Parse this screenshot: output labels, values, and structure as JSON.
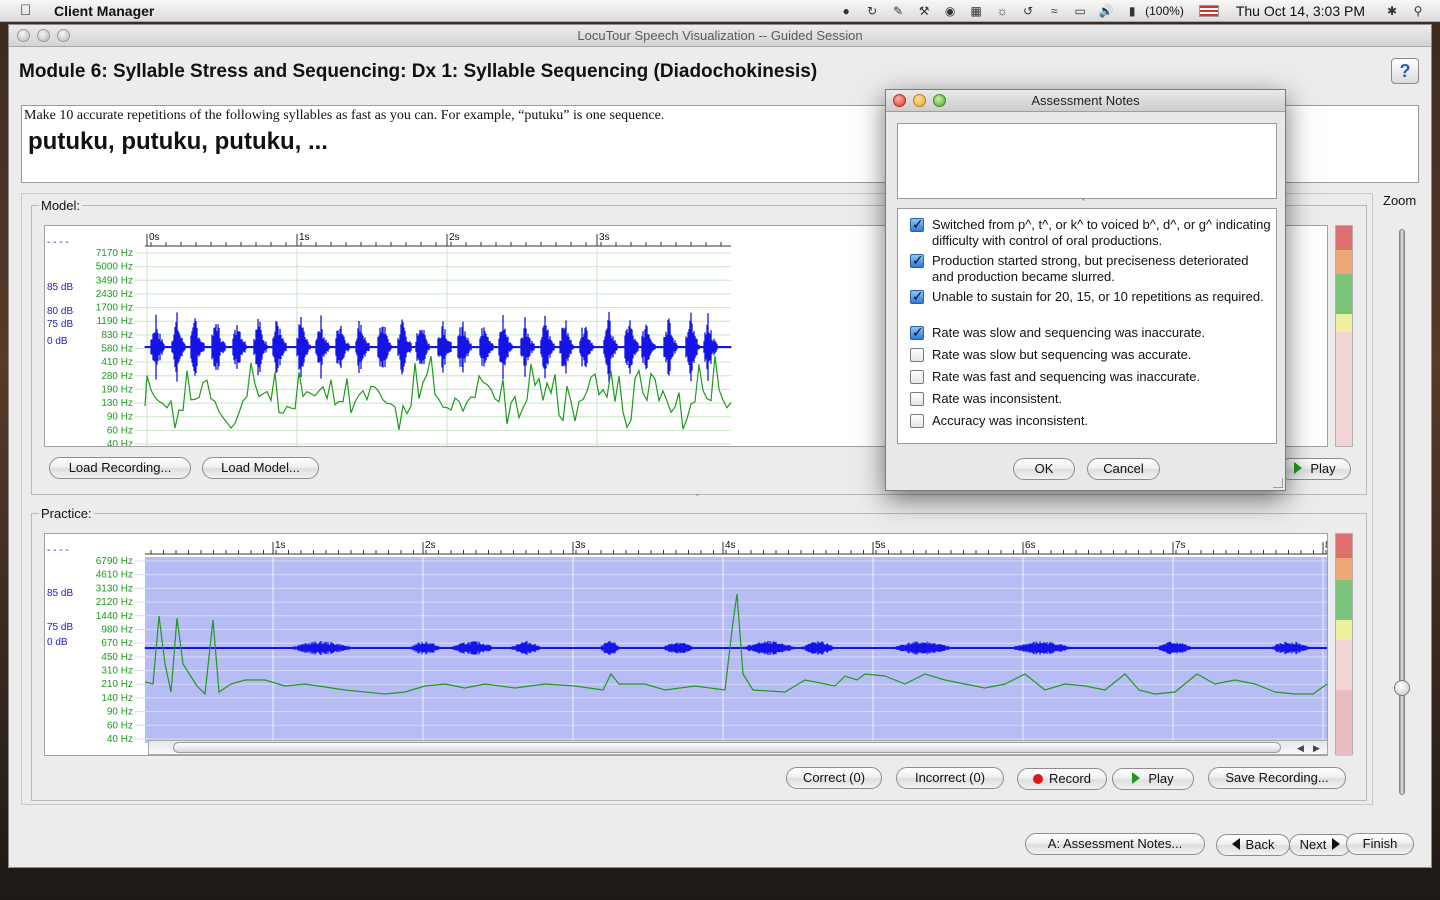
{
  "menubar": {
    "app_name": "Client Manager",
    "battery": "(100%)",
    "clock": "Thu Oct 14,  3:03 PM"
  },
  "window": {
    "title": "LocuTour Speech Visualization -- Guided Session",
    "module_title": "Module 6: Syllable Stress and Sequencing: Dx 1: Syllable Sequencing (Diadochokinesis)",
    "help_label": "?"
  },
  "instructions": {
    "text": "Make 10 accurate repetitions of the following syllables as fast as you can. For example, “putuku” is one sequence.",
    "target": "putuku, putuku, putuku, ..."
  },
  "model_panel": {
    "label": "Model:",
    "db_labels": [
      "85 dB",
      "80 dB",
      "75 dB",
      "0 dB"
    ],
    "freq_labels": [
      "7170 Hz",
      "5000 Hz",
      "3490 Hz",
      "2430 Hz",
      "1700 Hz",
      "1190 Hz",
      "830 Hz",
      "580 Hz",
      "410 Hz",
      "280 Hz",
      "190 Hz",
      "130 Hz",
      "90 Hz",
      "60 Hz",
      "40 Hz"
    ],
    "time_labels": [
      "0s",
      "1s",
      "2s",
      "3s"
    ],
    "load_recording": "Load Recording...",
    "load_model": "Load Model...",
    "play": "Play"
  },
  "practice_panel": {
    "label": "Practice:",
    "db_labels": [
      "85 dB",
      "75 dB",
      "0 dB"
    ],
    "freq_labels": [
      "6790 Hz",
      "4610 Hz",
      "3130 Hz",
      "2120 Hz",
      "1440 Hz",
      "980 Hz",
      "670 Hz",
      "450 Hz",
      "310 Hz",
      "210 Hz",
      "140 Hz",
      "90 Hz",
      "60 Hz",
      "40 Hz"
    ],
    "time_labels": [
      "1s",
      "2s",
      "3s",
      "4s",
      "5s",
      "6s",
      "7s",
      "8"
    ],
    "correct": "Correct (0)",
    "incorrect": "Incorrect (0)",
    "record": "Record",
    "play": "Play",
    "save_recording": "Save Recording..."
  },
  "zoom": {
    "label": "Zoom"
  },
  "footer": {
    "assessment_notes": "A: Assessment Notes...",
    "back": "Back",
    "next": "Next",
    "finish": "Finish"
  },
  "dialog": {
    "title": "Assessment Notes",
    "notes_value": "",
    "items": [
      {
        "label": "Switched from p^, t^, or k^ to voiced b^, d^, or g^ indicating difficulty with control of oral productions.",
        "checked": true
      },
      {
        "label": "Production started strong, but preciseness deteriorated and production became slurred.",
        "checked": true
      },
      {
        "label": "Unable to sustain for 20, 15, or 10 repetitions as required.",
        "checked": true
      },
      {
        "label": "Rate was slow and sequencing was inaccurate.",
        "checked": true
      },
      {
        "label": "Rate was slow but sequencing was accurate.",
        "checked": false
      },
      {
        "label": "Rate was fast and sequencing was inaccurate.",
        "checked": false
      },
      {
        "label": "Rate was inconsistent.",
        "checked": false
      },
      {
        "label": "Accuracy was inconsistent.",
        "checked": false
      }
    ],
    "ok": "OK",
    "cancel": "Cancel"
  },
  "colors": {
    "waveform": "#1414e6",
    "pitch": "#1e9a1e",
    "freq_label": "#1e9a1e",
    "db_label": "#2020c8",
    "practice_bg": "#b8bcf4",
    "meter_red": "#e07070",
    "meter_orange": "#eea878",
    "meter_green": "#7cc47c",
    "meter_yellow": "#eef0a0",
    "meter_pink": "#f2d4d8"
  }
}
